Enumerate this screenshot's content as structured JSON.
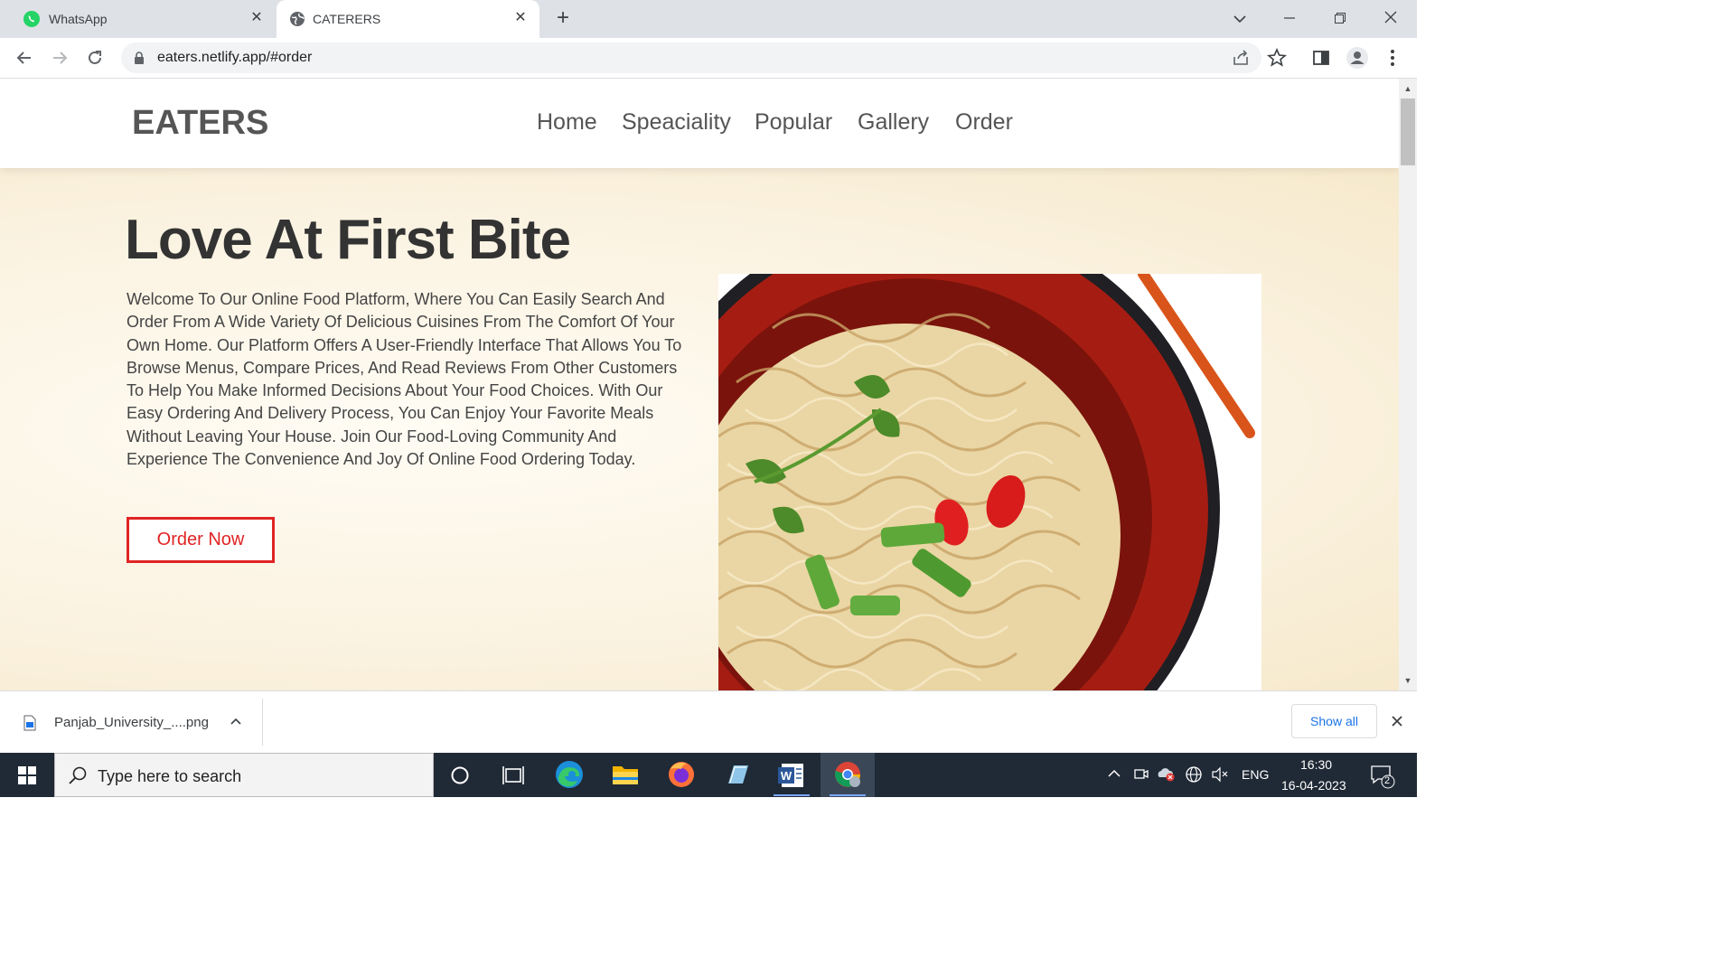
{
  "browser": {
    "tabs": [
      {
        "title": "WhatsApp",
        "active": false
      },
      {
        "title": "CATERERS",
        "active": true
      }
    ],
    "url": "eaters.netlify.app/#order"
  },
  "site": {
    "logo": "EATERS",
    "nav": [
      "Home",
      "Speaciality",
      "Popular",
      "Gallery",
      "Order"
    ],
    "hero": {
      "title": "Love At First Bite",
      "text": "Welcome To Our Online Food Platform, Where You Can Easily Search And Order From A Wide Variety Of Delicious Cuisines From The Comfort Of Your Own Home. Our Platform Offers A User-Friendly Interface That Allows You To Browse Menus, Compare Prices, And Read Reviews From Other Customers To Help You Make Informed Decisions About Your Food Choices. With Our Easy Ordering And Delivery Process, You Can Enjoy Your Favorite Meals Without Leaving Your House. Join Our Food-Loving Community And Experience The Convenience And Joy Of Online Food Ordering Today.",
      "button": "Order Now",
      "image": "noodle-bowl-image"
    },
    "colors": {
      "accent": "#e02424",
      "text": "#444444",
      "logo": "#555555"
    }
  },
  "downloads": {
    "file": "Panjab_University_....png",
    "show_all": "Show all"
  },
  "taskbar": {
    "search_placeholder": "Type here to search",
    "apps": [
      "cortana-icon",
      "task-view-icon",
      "edge-icon",
      "file-explorer-icon",
      "firefox-icon",
      "notepad-icon",
      "word-icon",
      "chrome-icon"
    ],
    "tray": {
      "language": "ENG",
      "time": "16:30",
      "date": "16-04-2023",
      "notifications": "2"
    }
  }
}
